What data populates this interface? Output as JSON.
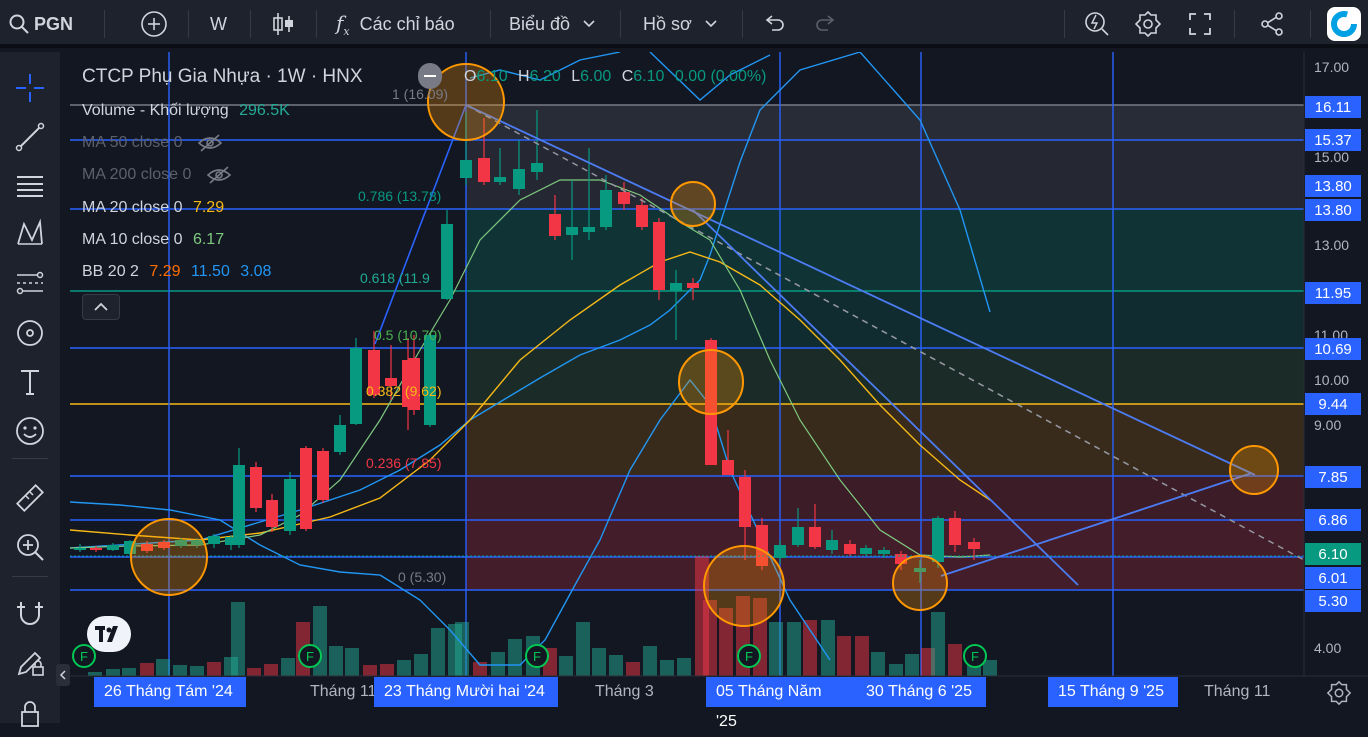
{
  "topbar": {
    "symbol": "PGN",
    "interval": "W",
    "indicators_label": "Các chỉ báo",
    "chart_type_label": "Biểu đồ",
    "profile_label": "Hồ sơ"
  },
  "legend": {
    "title": "CTCP Phụ Gia Nhựa · 1W · HNX",
    "o_label": "O",
    "o_value": "6.10",
    "h_label": "H",
    "h_value": "6.20",
    "l_label": "L",
    "l_value": "6.00",
    "c_label": "C",
    "c_value": "6.10",
    "change": "0.00 (0.00%)",
    "volume_label": "Volume - Khối lượng",
    "volume_value": "296.5K",
    "ma50": "MA 50 close 0",
    "ma200": "MA 200 close 0",
    "ma20": "MA 20 close 0",
    "ma20_value": "7.29",
    "ma10": "MA 10 close 0",
    "ma10_value": "6.17",
    "bb": "BB 20 2",
    "bb_basis": "7.29",
    "bb_upper": "11.50",
    "bb_lower": "3.08"
  },
  "fib_labels": {
    "l1": "1 (16.09)",
    "l0786": "0.786 (13.78)",
    "l0618": "0.618 (11.9",
    "l05": "0.5 (10.70)",
    "l0382": "0.382 (9.62)",
    "l0236": "0.236 (7.85)",
    "l0": "0 (5.30)"
  },
  "price_axis": {
    "ticks": [
      "17.00",
      "15.00",
      "13.00",
      "11.00",
      "10.00",
      "9.00",
      "4.00"
    ],
    "badges": [
      {
        "text": "16.11",
        "color": "#2962ff"
      },
      {
        "text": "15.37",
        "color": "#2962ff"
      },
      {
        "text": "13.80",
        "color": "#2962ff"
      },
      {
        "text": "13.80",
        "color": "#2962ff"
      },
      {
        "text": "11.95",
        "color": "#2962ff"
      },
      {
        "text": "10.69",
        "color": "#2962ff"
      },
      {
        "text": "9.44",
        "color": "#2962ff"
      },
      {
        "text": "7.85",
        "color": "#2962ff"
      },
      {
        "text": "6.86",
        "color": "#2962ff"
      },
      {
        "text": "6.10",
        "color": "#089981"
      },
      {
        "text": "6.01",
        "color": "#2962ff"
      },
      {
        "text": "5.30",
        "color": "#2962ff"
      }
    ]
  },
  "time_axis": {
    "d1": "26 Tháng Tám '24",
    "m1": "Tháng 11",
    "d2": "23 Tháng Mười hai '24",
    "m2": "Tháng 3",
    "d3": "05 Tháng Năm '25",
    "d4": "30 Tháng 6 '25",
    "d5": "15 Tháng 9 '25",
    "m3": "Tháng 11"
  },
  "colors": {
    "up": "#089981",
    "down": "#f23645",
    "accent": "#2962ff"
  },
  "earnings_marker": "F",
  "collapse_icon": "chevron-up-icon"
}
